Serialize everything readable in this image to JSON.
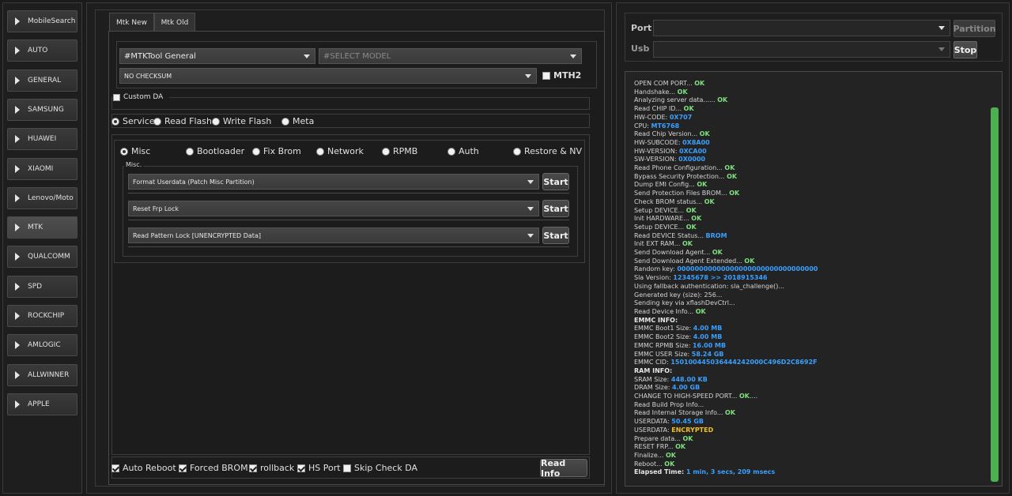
{
  "sidebar": {
    "items": [
      {
        "label": "MobileSearch",
        "active": false
      },
      {
        "label": "AUTO",
        "active": false
      },
      {
        "label": "GENERAL",
        "active": false
      },
      {
        "label": "SAMSUNG",
        "active": false
      },
      {
        "label": "HUAWEI",
        "active": false
      },
      {
        "label": "XIAOMI",
        "active": false
      },
      {
        "label": "Lenovo/Moto",
        "active": false
      },
      {
        "label": "MTK",
        "active": true
      },
      {
        "label": "QUALCOMM",
        "active": false
      },
      {
        "label": "SPD",
        "active": false
      },
      {
        "label": "ROCKCHIP",
        "active": false
      },
      {
        "label": "AMLOGIC",
        "active": false
      },
      {
        "label": "ALLWINNER",
        "active": false
      },
      {
        "label": "APPLE",
        "active": false
      }
    ]
  },
  "tabs": [
    {
      "label": "Mtk New",
      "active": true
    },
    {
      "label": "Mtk Old",
      "active": false
    }
  ],
  "config": {
    "tool_select": "#MTKTool General",
    "model_select": "#SELECT MODEL",
    "checksum_select": "NO CHECKSUM",
    "mth2_label": "MTH2",
    "mth2_checked": false,
    "custom_da_label": "Custom DA",
    "custom_da_checked": false
  },
  "modes": [
    {
      "label": "Service",
      "selected": true
    },
    {
      "label": "Read Flash",
      "selected": false
    },
    {
      "label": "Write Flash",
      "selected": false
    },
    {
      "label": "Meta",
      "selected": false
    }
  ],
  "subtabs": [
    {
      "label": "Misc",
      "selected": true
    },
    {
      "label": "Bootloader",
      "selected": false
    },
    {
      "label": "Fix Brom",
      "selected": false
    },
    {
      "label": "Network",
      "selected": false
    },
    {
      "label": "RPMB",
      "selected": false
    },
    {
      "label": "Auth",
      "selected": false
    },
    {
      "label": "Restore & NV",
      "selected": false
    }
  ],
  "misc": {
    "group_label": "Misc.",
    "operations": [
      {
        "select": "Format Userdata (Patch Misc Partition)",
        "button": "Start"
      },
      {
        "select": "Reset Frp Lock",
        "button": "Start"
      },
      {
        "select": "Read Pattern Lock [UNENCRYPTED Data]",
        "button": "Start"
      }
    ]
  },
  "options": [
    {
      "label": "Auto Reboot",
      "checked": true
    },
    {
      "label": "Forced BROM",
      "checked": true
    },
    {
      "label": "rollback",
      "checked": true
    },
    {
      "label": "HS Port",
      "checked": true
    },
    {
      "label": "Skip Check DA",
      "checked": false
    }
  ],
  "read_info_label": "Read Info",
  "port_panel": {
    "port_label": "Port",
    "usb_label": "Usb",
    "port_value": "",
    "usb_value": "",
    "partition_label": "Partition",
    "stop_label": "Stop"
  },
  "log": [
    [
      {
        "t": "OPEN COM PORT... "
      },
      {
        "t": "OK",
        "c": "ok"
      }
    ],
    [
      {
        "t": "Handshake... "
      },
      {
        "t": "OK",
        "c": "ok"
      }
    ],
    [
      {
        "t": "Analyzing server data...... "
      },
      {
        "t": "OK",
        "c": "ok"
      }
    ],
    [
      {
        "t": "Read CHIP ID... "
      },
      {
        "t": "OK",
        "c": "ok"
      }
    ],
    [
      {
        "t": "HW-CODE: "
      },
      {
        "t": "0X707",
        "c": "blue"
      }
    ],
    [
      {
        "t": "CPU: "
      },
      {
        "t": "MT6768",
        "c": "blue"
      }
    ],
    [
      {
        "t": "Read Chip Version... "
      },
      {
        "t": "OK",
        "c": "ok"
      }
    ],
    [
      {
        "t": "HW-SUBCODE: "
      },
      {
        "t": "0X8A00",
        "c": "blue"
      }
    ],
    [
      {
        "t": "HW-VERSION: "
      },
      {
        "t": "0XCA00",
        "c": "blue"
      }
    ],
    [
      {
        "t": "SW-VERSION: "
      },
      {
        "t": "0X0000",
        "c": "blue"
      }
    ],
    [
      {
        "t": "Read Phone Configuration... "
      },
      {
        "t": "OK",
        "c": "ok"
      }
    ],
    [
      {
        "t": "Bypass Security Protection... "
      },
      {
        "t": "OK",
        "c": "ok"
      }
    ],
    [
      {
        "t": "Dump EMI Config... "
      },
      {
        "t": "OK",
        "c": "ok"
      }
    ],
    [
      {
        "t": "Send Protection Files BROM... "
      },
      {
        "t": "OK",
        "c": "ok"
      }
    ],
    [
      {
        "t": "Check BROM status... "
      },
      {
        "t": "OK",
        "c": "ok"
      }
    ],
    [
      {
        "t": "Setup DEVICE... "
      },
      {
        "t": "OK",
        "c": "ok"
      }
    ],
    [
      {
        "t": "Init HARDWARE... "
      },
      {
        "t": "OK",
        "c": "ok"
      }
    ],
    [
      {
        "t": "Setup DEVICE... "
      },
      {
        "t": "OK",
        "c": "ok"
      }
    ],
    [
      {
        "t": "Read DEVICE Status... "
      },
      {
        "t": "BROM",
        "c": "blue"
      }
    ],
    [
      {
        "t": "Init EXT RAM... "
      },
      {
        "t": "OK",
        "c": "ok"
      }
    ],
    [
      {
        "t": "Send Download Agent... "
      },
      {
        "t": "OK",
        "c": "ok"
      }
    ],
    [
      {
        "t": "Send Download Agent Extended... "
      },
      {
        "t": "OK",
        "c": "ok"
      }
    ],
    [
      {
        "t": "Random key:  "
      },
      {
        "t": "00000000000000000000000000000000",
        "c": "blue"
      }
    ],
    [
      {
        "t": "Sla Version:  "
      },
      {
        "t": "12345678  >> 2018915346",
        "c": "blue"
      }
    ],
    [
      {
        "t": "Using fallback authentication: sla_challenge()..."
      }
    ],
    [
      {
        "t": "Generated key (size): 256..."
      }
    ],
    [
      {
        "t": "Sending key via xflashDevCtrl..."
      }
    ],
    [
      {
        "t": "Read Device Info... "
      },
      {
        "t": "OK",
        "c": "ok"
      }
    ],
    [
      {
        "t": "EMMC INFO:",
        "c": "bold"
      }
    ],
    [
      {
        "t": "EMMC Boot1 Size: "
      },
      {
        "t": "4.00 MB",
        "c": "blue"
      }
    ],
    [
      {
        "t": "EMMC Boot2 Size: "
      },
      {
        "t": "4.00 MB",
        "c": "blue"
      }
    ],
    [
      {
        "t": "EMMC RPMB Size: "
      },
      {
        "t": "16.00 MB",
        "c": "blue"
      }
    ],
    [
      {
        "t": "EMMC USER Size: "
      },
      {
        "t": "58.24 GB",
        "c": "blue"
      }
    ],
    [
      {
        "t": "EMMC CID: "
      },
      {
        "t": "150100445036444242000C496D2C8692F",
        "c": "blue"
      }
    ],
    [
      {
        "t": "RAM INFO:",
        "c": "bold"
      }
    ],
    [
      {
        "t": "SRAM Size: "
      },
      {
        "t": "448.00 KB",
        "c": "blue"
      }
    ],
    [
      {
        "t": "DRAM Size: "
      },
      {
        "t": "4.00 GB",
        "c": "blue"
      }
    ],
    [
      {
        "t": "CHANGE TO HIGH-SPEED PORT... "
      },
      {
        "t": "OK",
        "c": "ok"
      },
      {
        "t": "...."
      }
    ],
    [
      {
        "t": "Read Build Prop Info..."
      }
    ],
    [
      {
        "t": "Read Internal Storage Info... "
      },
      {
        "t": "OK",
        "c": "ok"
      }
    ],
    [
      {
        "t": "USERDATA: "
      },
      {
        "t": "50.45 GB",
        "c": "blue"
      }
    ],
    [
      {
        "t": "USERDATA: "
      },
      {
        "t": "ENCRYPTED",
        "c": "yellow"
      }
    ],
    [
      {
        "t": "Prepare data... "
      },
      {
        "t": "OK",
        "c": "ok"
      }
    ],
    [
      {
        "t": "RESET FRP... "
      },
      {
        "t": "OK",
        "c": "ok"
      }
    ],
    [
      {
        "t": "Finalize... "
      },
      {
        "t": "OK",
        "c": "ok"
      }
    ],
    [
      {
        "t": "Reboot... "
      },
      {
        "t": "OK",
        "c": "ok"
      }
    ],
    [
      {
        "t": "Elapsed Time: ",
        "c": "bold"
      },
      {
        "t": "1 min, 3 secs, 209 msecs",
        "c": "blue"
      }
    ]
  ],
  "colors": {
    "ok": "#7fe07f",
    "value": "#3aa0ff",
    "warning": "#f0c020",
    "scrollbar": "#4caf50"
  }
}
